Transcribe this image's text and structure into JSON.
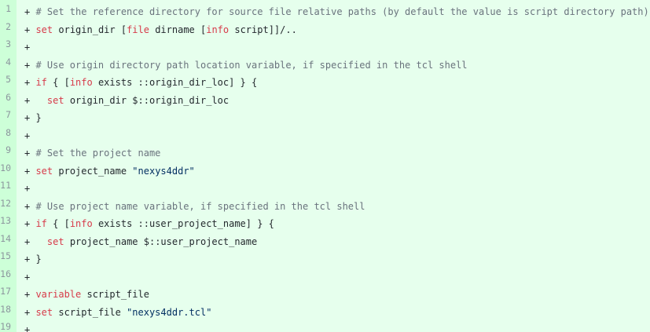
{
  "diff": {
    "lines": [
      {
        "num": "1",
        "tokens": [
          {
            "t": "p",
            "v": "+ "
          },
          {
            "t": "c",
            "v": "# Set the reference directory for source file relative paths (by default the value is script directory path)"
          }
        ]
      },
      {
        "num": "2",
        "tokens": [
          {
            "t": "p",
            "v": "+ "
          },
          {
            "t": "k",
            "v": "set"
          },
          {
            "t": "p",
            "v": " origin_dir ["
          },
          {
            "t": "k",
            "v": "file"
          },
          {
            "t": "p",
            "v": " dirname ["
          },
          {
            "t": "k",
            "v": "info"
          },
          {
            "t": "p",
            "v": " script]]/.."
          }
        ]
      },
      {
        "num": "3",
        "tokens": [
          {
            "t": "p",
            "v": "+"
          }
        ]
      },
      {
        "num": "4",
        "tokens": [
          {
            "t": "p",
            "v": "+ "
          },
          {
            "t": "c",
            "v": "# Use origin directory path location variable, if specified in the tcl shell"
          }
        ]
      },
      {
        "num": "5",
        "tokens": [
          {
            "t": "p",
            "v": "+ "
          },
          {
            "t": "k",
            "v": "if"
          },
          {
            "t": "p",
            "v": " { ["
          },
          {
            "t": "k",
            "v": "info"
          },
          {
            "t": "p",
            "v": " exists ::origin_dir_loc] } {"
          }
        ]
      },
      {
        "num": "6",
        "tokens": [
          {
            "t": "p",
            "v": "+   "
          },
          {
            "t": "k",
            "v": "set"
          },
          {
            "t": "p",
            "v": " origin_dir $::origin_dir_loc"
          }
        ]
      },
      {
        "num": "7",
        "tokens": [
          {
            "t": "p",
            "v": "+ }"
          }
        ]
      },
      {
        "num": "8",
        "tokens": [
          {
            "t": "p",
            "v": "+"
          }
        ]
      },
      {
        "num": "9",
        "tokens": [
          {
            "t": "p",
            "v": "+ "
          },
          {
            "t": "c",
            "v": "# Set the project name"
          }
        ]
      },
      {
        "num": "10",
        "tokens": [
          {
            "t": "p",
            "v": "+ "
          },
          {
            "t": "k",
            "v": "set"
          },
          {
            "t": "p",
            "v": " project_name "
          },
          {
            "t": "s",
            "v": "\"nexys4ddr\""
          }
        ]
      },
      {
        "num": "11",
        "tokens": [
          {
            "t": "p",
            "v": "+"
          }
        ]
      },
      {
        "num": "12",
        "tokens": [
          {
            "t": "p",
            "v": "+ "
          },
          {
            "t": "c",
            "v": "# Use project name variable, if specified in the tcl shell"
          }
        ]
      },
      {
        "num": "13",
        "tokens": [
          {
            "t": "p",
            "v": "+ "
          },
          {
            "t": "k",
            "v": "if"
          },
          {
            "t": "p",
            "v": " { ["
          },
          {
            "t": "k",
            "v": "info"
          },
          {
            "t": "p",
            "v": " exists ::user_project_name] } {"
          }
        ]
      },
      {
        "num": "14",
        "tokens": [
          {
            "t": "p",
            "v": "+   "
          },
          {
            "t": "k",
            "v": "set"
          },
          {
            "t": "p",
            "v": " project_name $::user_project_name"
          }
        ]
      },
      {
        "num": "15",
        "tokens": [
          {
            "t": "p",
            "v": "+ }"
          }
        ]
      },
      {
        "num": "16",
        "tokens": [
          {
            "t": "p",
            "v": "+"
          }
        ]
      },
      {
        "num": "17",
        "tokens": [
          {
            "t": "p",
            "v": "+ "
          },
          {
            "t": "k",
            "v": "variable"
          },
          {
            "t": "p",
            "v": " script_file"
          }
        ]
      },
      {
        "num": "18",
        "tokens": [
          {
            "t": "p",
            "v": "+ "
          },
          {
            "t": "k",
            "v": "set"
          },
          {
            "t": "p",
            "v": " script_file "
          },
          {
            "t": "s",
            "v": "\"nexys4ddr.tcl\""
          }
        ]
      },
      {
        "num": "19",
        "tokens": [
          {
            "t": "p",
            "v": "+"
          }
        ]
      }
    ]
  },
  "colors": {
    "added_background": "#e6ffed",
    "gutter_background": "#cdffd8",
    "comment": "#6a737d",
    "keyword": "#d73a49",
    "string": "#032f62",
    "text": "#24292e",
    "line_number": "#8c969e"
  }
}
